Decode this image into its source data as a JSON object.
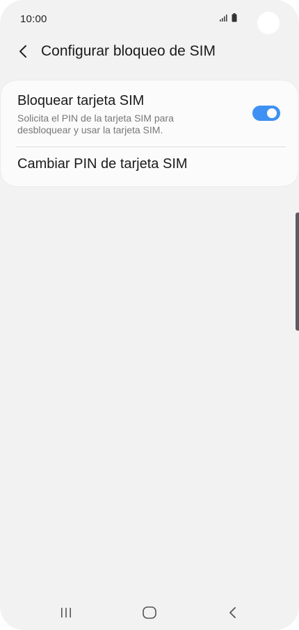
{
  "status_bar": {
    "time": "10:00",
    "icons": [
      "signal-icon",
      "battery-icon"
    ]
  },
  "app_bar": {
    "back_icon": "chevron-left-icon",
    "title": "Configurar bloqueo de SIM"
  },
  "settings": {
    "lock_sim": {
      "title": "Bloquear tarjeta SIM",
      "description": "Solicita el PIN de la tarjeta SIM para desbloquear y usar la tarjeta SIM.",
      "enabled": true
    },
    "change_pin": {
      "title": "Cambiar PIN de tarjeta SIM"
    }
  },
  "nav_bar": {
    "icons": [
      "recent-apps-icon",
      "home-icon",
      "back-icon"
    ]
  },
  "colors": {
    "accent": "#3e91f3",
    "background": "#f2f2f2",
    "card": "#fbfbfb"
  }
}
